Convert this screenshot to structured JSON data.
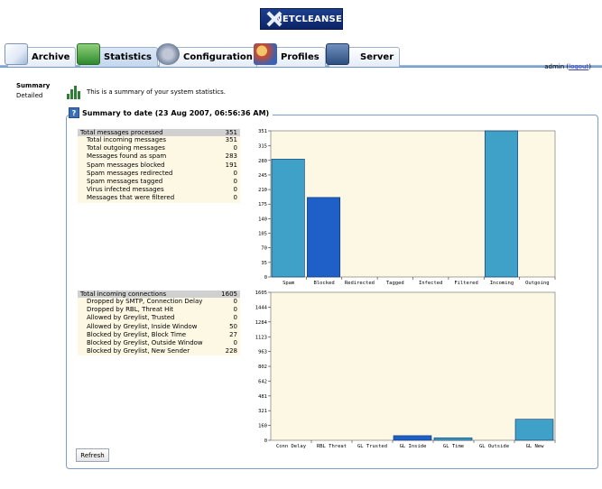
{
  "logo": {
    "text": "NETCLEANSE"
  },
  "tabs": [
    {
      "label": "Archive",
      "icon": "mail-icon"
    },
    {
      "label": "Statistics",
      "icon": "chart-icon"
    },
    {
      "label": "Configuration",
      "icon": "gear-icon"
    },
    {
      "label": "Profiles",
      "icon": "users-icon"
    },
    {
      "label": "Server",
      "icon": "server-icon"
    }
  ],
  "user": {
    "name": "admin",
    "logout": "logout"
  },
  "sidebar": {
    "items": [
      {
        "label": "Summary"
      },
      {
        "label": "Detailed"
      }
    ]
  },
  "intro": "This is a summary of your system statistics.",
  "panel": {
    "title": "Summary to date (23 Aug 2007, 06:56:36 AM)"
  },
  "messages": {
    "header": {
      "label": "Total messages processed",
      "value": "351"
    },
    "rows": [
      {
        "label": "Total incoming messages",
        "value": "351"
      },
      {
        "label": "Total outgoing messages",
        "value": "0"
      },
      {
        "label": "Messages found as spam",
        "value": "283"
      },
      {
        "label": "Spam messages blocked",
        "value": "191"
      },
      {
        "label": "Spam messages redirected",
        "value": "0"
      },
      {
        "label": "Spam messages tagged",
        "value": "0"
      },
      {
        "label": "Virus infected messages",
        "value": "0"
      },
      {
        "label": "Messages that were filtered",
        "value": "0"
      }
    ]
  },
  "connections": {
    "header": {
      "label": "Total incoming connections",
      "value": "1605"
    },
    "rows": [
      {
        "label": "Dropped by SMTP, Connection Delay",
        "value": "0"
      },
      {
        "label": "Dropped by RBL, Threat Hit",
        "value": "0"
      },
      {
        "label": "Allowed by Greylist, Trusted",
        "value": "0"
      },
      {
        "label": "Allowed by Greylist, Inside Window",
        "value": "50"
      },
      {
        "label": "Blocked by Greylist, Block Time",
        "value": "27"
      },
      {
        "label": "Blocked by Greylist, Outside Window",
        "value": "0"
      },
      {
        "label": "Blocked by Greylist, New Sender",
        "value": "228"
      }
    ]
  },
  "refresh_label": "Refresh",
  "colors": {
    "light_bar": "#3fa0c8",
    "dark_bar": "#1f5fc8",
    "plot_bg": "#fdf8e4"
  },
  "chart_data": [
    {
      "type": "bar",
      "categories": [
        "Spam",
        "Blocked",
        "Redirected",
        "Tagged",
        "Infected",
        "Filtered",
        "Incoming",
        "Outgoing"
      ],
      "values": [
        283,
        191,
        0,
        0,
        0,
        0,
        351,
        0
      ],
      "yticks": [
        0,
        35,
        70,
        105,
        140,
        175,
        210,
        245,
        280,
        315,
        351
      ],
      "ylim": [
        0,
        351
      ]
    },
    {
      "type": "bar",
      "categories": [
        "Conn Delay",
        "RBL Threat",
        "GL Trusted",
        "GL Inside",
        "GL Time",
        "GL Outside",
        "GL New"
      ],
      "values": [
        0,
        0,
        0,
        50,
        27,
        0,
        228
      ],
      "yticks": [
        0,
        160,
        321,
        481,
        642,
        802,
        963,
        1123,
        1284,
        1444,
        1605
      ],
      "ylim": [
        0,
        1605
      ]
    }
  ]
}
